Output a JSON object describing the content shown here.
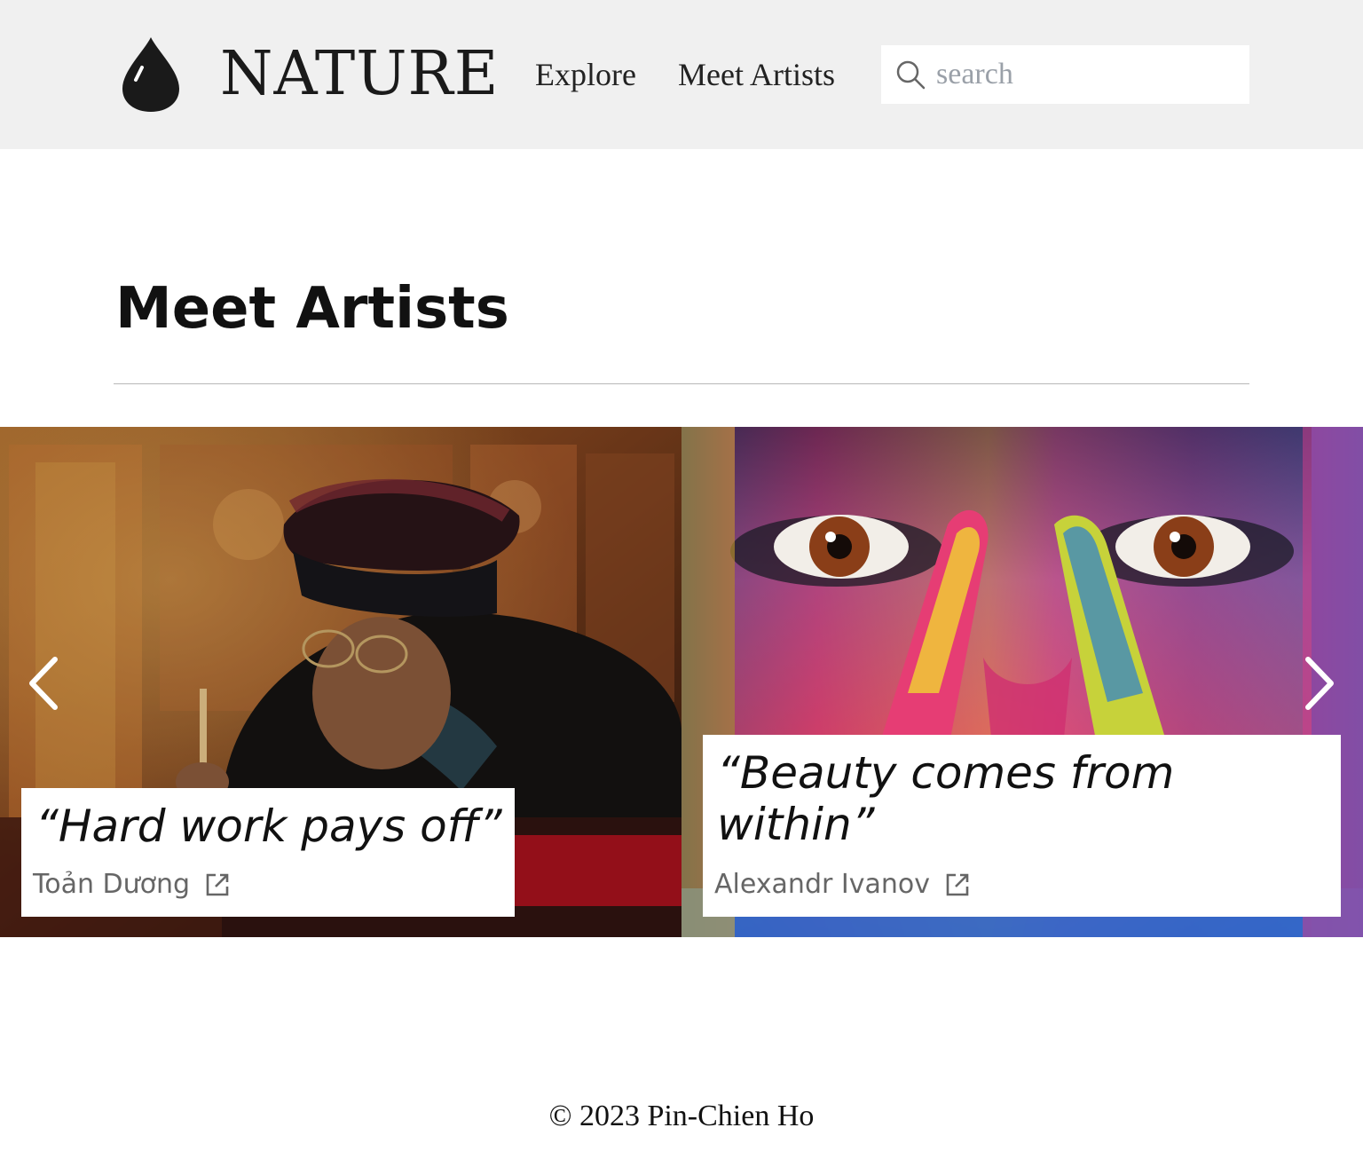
{
  "header": {
    "brand": "NATURE",
    "logo_icon": "water-drop-icon",
    "nav": [
      {
        "label": "Explore"
      },
      {
        "label": "Meet Artists"
      }
    ],
    "search": {
      "placeholder": "search",
      "value": "",
      "icon": "search-icon"
    }
  },
  "main": {
    "title": "Meet Artists"
  },
  "carousel": {
    "prev_icon": "chevron-left-icon",
    "next_icon": "chevron-right-icon",
    "slides": [
      {
        "quote": "“Hard work pays off”",
        "artist": "Toản Dương",
        "link_icon": "external-link-icon"
      },
      {
        "quote": "“Beauty comes from within”",
        "artist": "Alexandr Ivanov",
        "link_icon": "external-link-icon"
      }
    ]
  },
  "footer": {
    "text": "© 2023 Pin-Chien Ho"
  },
  "colors": {
    "header_bg": "#f0f0f0",
    "text": "#111111",
    "muted": "#666666",
    "placeholder": "#9aa0a8",
    "divider": "#b8b8b8"
  }
}
